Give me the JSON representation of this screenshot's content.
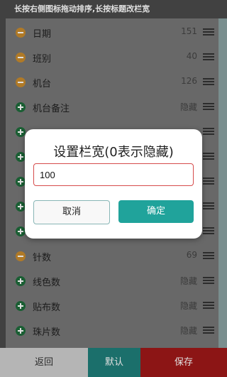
{
  "header": {
    "hint": "长按右侧图标拖动排序,长按标题改栏宽"
  },
  "rows": [
    {
      "icon": "minus-icon",
      "name": "日期",
      "value": "151"
    },
    {
      "icon": "minus-icon",
      "name": "班别",
      "value": "40"
    },
    {
      "icon": "minus-icon",
      "name": "机台",
      "value": "126"
    },
    {
      "icon": "plus-icon",
      "name": "机台备注",
      "value": "隐藏"
    },
    {
      "icon": "plus-icon",
      "name": "",
      "value": ""
    },
    {
      "icon": "plus-icon",
      "name": "",
      "value": ""
    },
    {
      "icon": "plus-icon",
      "name": "",
      "value": ""
    },
    {
      "icon": "plus-icon",
      "name": "",
      "value": ""
    },
    {
      "icon": "plus-icon",
      "name": "",
      "value": ""
    },
    {
      "icon": "minus-icon",
      "name": "针数",
      "value": "69"
    },
    {
      "icon": "plus-icon",
      "name": "线色数",
      "value": "隐藏"
    },
    {
      "icon": "plus-icon",
      "name": "贴布数",
      "value": "隐藏"
    },
    {
      "icon": "plus-icon",
      "name": "珠片数",
      "value": "隐藏"
    }
  ],
  "footer": {
    "back_label": "返回",
    "default_label": "默认",
    "save_label": "保存"
  },
  "dialog": {
    "title": "设置栏宽(0表示隐藏)",
    "input_value": "100",
    "cancel_label": "取消",
    "confirm_label": "确定"
  },
  "colors": {
    "minus": "#c98b2d",
    "plus": "#1e6b3b",
    "accent": "#20a39b",
    "save": "#a01818"
  }
}
